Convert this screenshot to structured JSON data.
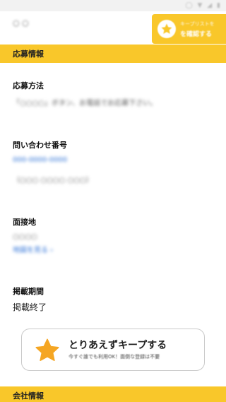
{
  "status_bar": {
    "icons": "◯ ▼ ◢ ▮",
    "left_text": ""
  },
  "top_blurred": "○ ○",
  "keep_badge": {
    "line1": "キープリストを",
    "line2": "を確認する",
    "accent": "#f9c72a"
  },
  "sections": {
    "apply": "応募情報",
    "company": "会社情報"
  },
  "fields": {
    "method_label": "応募方法",
    "method_value": "「○○○○」ボタン、お電話でお応募下さい。",
    "inquiry_label": "問い合わせ番号",
    "inquiry_link": "000-0000-0000",
    "inquiry_note": "（○○○ ○○○○  ○○○）",
    "interview_label": "面接地",
    "interview_value": "○○○○",
    "interview_link": "地図を見る ›",
    "period_label": "掲載期間",
    "period_value": "掲載終了"
  },
  "keep_button": {
    "main": "とりあえずキープする",
    "sub": "今すぐ誰でも利用OK！面倒な登録は不要",
    "star_color": "#f5a623"
  }
}
